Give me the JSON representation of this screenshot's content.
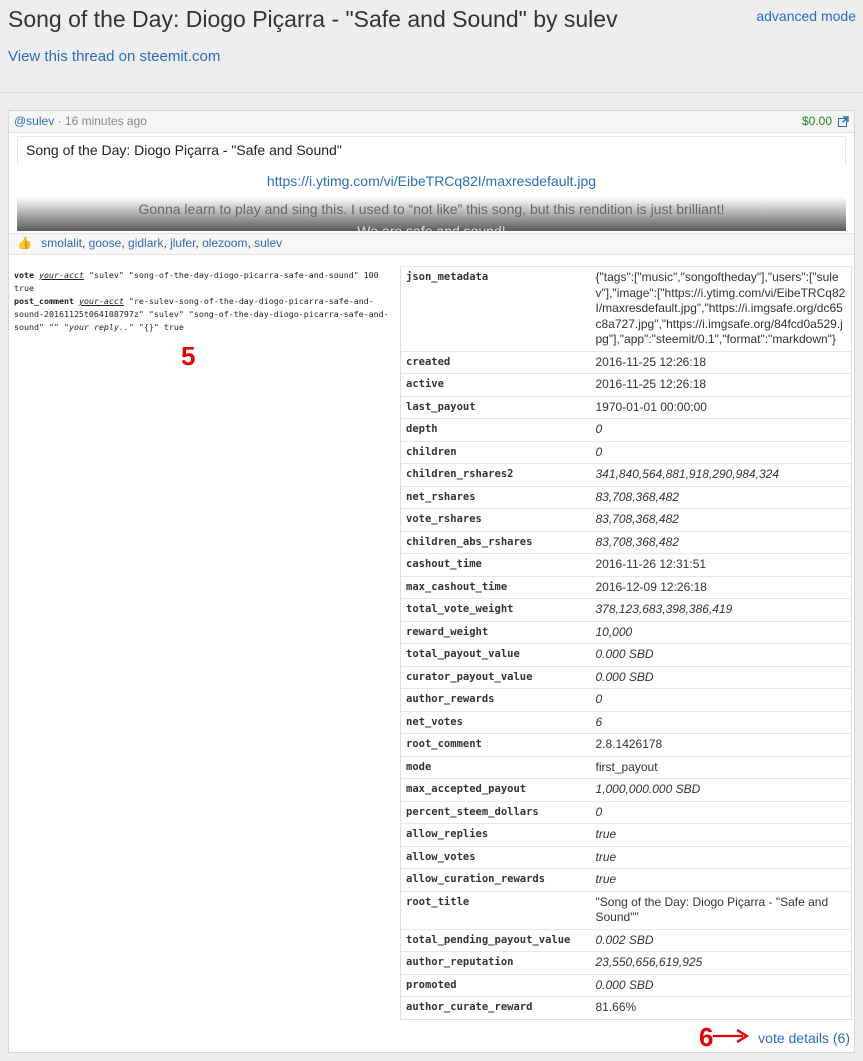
{
  "page": {
    "title": "Song of the Day: Diogo Piçarra - \"Safe and Sound\" by sulev",
    "advanced_mode": "advanced mode",
    "thread_link": "View this thread on steemit.com"
  },
  "post": {
    "author": "@sulev",
    "age": "16 minutes ago",
    "payout": "$0.00",
    "title": "Song of the Day: Diogo Piçarra - \"Safe and Sound\"",
    "image_url": "https://i.ytimg.com/vi/EibeTRCq82I/maxresdefault.jpg",
    "body_line": "Gonna learn to play and sing this. I used to “not like” this song, but this rendition is just brilliant!",
    "body_line2": "We are safe and sound!",
    "voters": [
      "smolalit",
      "goose",
      "gidlark",
      "jlufer",
      "olezoom",
      "sulev"
    ],
    "vote_details": "vote details (6)"
  },
  "commands": {
    "vote_cmd": "vote",
    "vote_acct": "your-acct",
    "vote_args": "\"sulev\" \"song-of-the-day-diogo-picarra-safe-and-sound\" 100 true",
    "comment_cmd": "post_comment",
    "comment_acct": "your-acct",
    "comment_args": "\"re-sulev-song-of-the-day-diogo-picarra-safe-and-sound-20161125t064108797z\" \"sulev\" \"song-of-the-day-diogo-picarra-safe-and-sound\" \"\"",
    "comment_reply": "\"your reply..\"",
    "comment_tail": "\"{}\" true"
  },
  "annotations": {
    "five": "5",
    "six": "6",
    "color": "#e00000"
  },
  "metadata": [
    {
      "key": "json_metadata",
      "value": "{\"tags\":[\"music\",\"songoftheday\"],\"users\":[\"sulev\"],\"image\":[\"https://i.ytimg.com/vi/EibeTRCq82I/maxresdefault.jpg\",\"https://i.imgsafe.org/dc65c8a727.jpg\",\"https://i.imgsafe.org/84fcd0a529.jpg\"],\"app\":\"steemit/0.1\",\"format\":\"markdown\"}",
      "italic": false
    },
    {
      "key": "created",
      "value": "2016-11-25 12:26:18",
      "italic": false
    },
    {
      "key": "active",
      "value": "2016-11-25 12:26:18",
      "italic": false
    },
    {
      "key": "last_payout",
      "value": "1970-01-01 00:00:00",
      "italic": false
    },
    {
      "key": "depth",
      "value": "0",
      "italic": true
    },
    {
      "key": "children",
      "value": "0",
      "italic": true
    },
    {
      "key": "children_rshares2",
      "value": "341,840,564,881,918,290,984,324",
      "italic": true
    },
    {
      "key": "net_rshares",
      "value": "83,708,368,482",
      "italic": true
    },
    {
      "key": "vote_rshares",
      "value": "83,708,368,482",
      "italic": true
    },
    {
      "key": "children_abs_rshares",
      "value": "83,708,368,482",
      "italic": true
    },
    {
      "key": "cashout_time",
      "value": "2016-11-26 12:31:51",
      "italic": false
    },
    {
      "key": "max_cashout_time",
      "value": "2016-12-09 12:26:18",
      "italic": false
    },
    {
      "key": "total_vote_weight",
      "value": "378,123,683,398,386,419",
      "italic": true
    },
    {
      "key": "reward_weight",
      "value": "10,000",
      "italic": true
    },
    {
      "key": "total_payout_value",
      "value": "0.000 SBD",
      "italic": true
    },
    {
      "key": "curator_payout_value",
      "value": "0.000 SBD",
      "italic": true
    },
    {
      "key": "author_rewards",
      "value": "0",
      "italic": true
    },
    {
      "key": "net_votes",
      "value": "6",
      "italic": true
    },
    {
      "key": "root_comment",
      "value": "2.8.1426178",
      "italic": false
    },
    {
      "key": "mode",
      "value": "first_payout",
      "italic": false
    },
    {
      "key": "max_accepted_payout",
      "value": "1,000,000.000 SBD",
      "italic": true
    },
    {
      "key": "percent_steem_dollars",
      "value": "0",
      "italic": true
    },
    {
      "key": "allow_replies",
      "value": "true",
      "italic": true
    },
    {
      "key": "allow_votes",
      "value": "true",
      "italic": true
    },
    {
      "key": "allow_curation_rewards",
      "value": "true",
      "italic": true
    },
    {
      "key": "root_title",
      "value": "\"Song of the Day: Diogo Piçarra - \"Safe and Sound\"\"",
      "italic": false
    },
    {
      "key": "total_pending_payout_value",
      "value": "0.002 SBD",
      "italic": true
    },
    {
      "key": "author_reputation",
      "value": "23,550,656,619,925",
      "italic": true
    },
    {
      "key": "promoted",
      "value": "0.000 SBD",
      "italic": true
    },
    {
      "key": "author_curate_reward",
      "value": "81.66%",
      "italic": false
    }
  ]
}
